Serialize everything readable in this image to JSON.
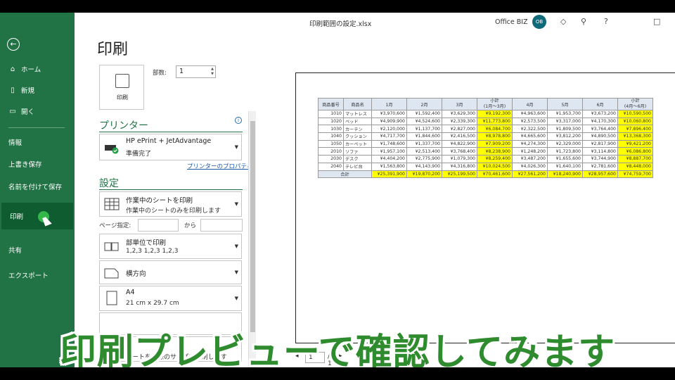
{
  "window": {
    "file_title": "印刷範囲の設定.xlsx",
    "account_name": "Office BIZ",
    "avatar_initials": "OB",
    "icons": [
      "diamond-icon",
      "share-icon",
      "help-icon",
      "maximize-icon"
    ],
    "help_label": "?"
  },
  "nav": {
    "back_label": "←",
    "items": [
      {
        "label": "ホーム",
        "icon": "home-icon"
      },
      {
        "label": "新規",
        "icon": "new-file-icon"
      },
      {
        "label": "開く",
        "icon": "folder-open-icon"
      },
      {
        "label": "情報"
      },
      {
        "label": "上書き保存"
      },
      {
        "label": "名前を付けて保存"
      },
      {
        "label": "印刷"
      },
      {
        "label": "共有"
      },
      {
        "label": "エクスポート"
      }
    ],
    "accent": "#217346"
  },
  "print": {
    "title": "印刷",
    "print_button_label": "印刷",
    "copies_label": "部数:",
    "copies_value": "1",
    "printer_section": "プリンター",
    "printer_name": "HP ePrint + JetAdvantage",
    "printer_status": "準備完了",
    "printer_properties": "プリンターのプロパティ",
    "settings_section": "設定",
    "settings": [
      {
        "line1": "作業中のシートを印刷",
        "line2": "作業中のシートのみを印刷します"
      },
      {
        "line1": "部単位で印刷",
        "line2": "1,2,3    1,2,3    1,2,3"
      },
      {
        "line1": "横方向",
        "line2": ""
      },
      {
        "line1": "A4",
        "line2": "21 cm x 29.7 cm"
      }
    ],
    "pages_label": "ページ指定:",
    "pages_to": "から",
    "scaling_partial": "シートを実際のサイズで印刷します"
  },
  "preview": {
    "page_current": "1",
    "page_total": "/ 1",
    "headers": [
      "商品番号",
      "商品名",
      "1月",
      "2月",
      "3月",
      "小計\n(1月～3月)",
      "4月",
      "5月",
      "6月",
      "小計\n(4月～6月)"
    ],
    "rows": [
      [
        "1010",
        "マットレス",
        "¥3,970,600",
        "¥1,592,400",
        "¥3,629,300",
        "¥9,192,300",
        "¥4,963,600",
        "¥1,953,700",
        "¥3,673,200",
        "¥10,590,500"
      ],
      [
        "1020",
        "ベッド",
        "¥4,909,900",
        "¥4,524,600",
        "¥2,339,300",
        "¥11,773,800",
        "¥2,573,500",
        "¥3,317,000",
        "¥4,170,300",
        "¥10,060,800"
      ],
      [
        "1030",
        "カーテン",
        "¥2,120,000",
        "¥1,137,700",
        "¥2,827,000",
        "¥6,084,700",
        "¥2,322,500",
        "¥1,809,500",
        "¥3,764,400",
        "¥7,896,400"
      ],
      [
        "1040",
        "クッション",
        "¥4,717,700",
        "¥1,844,600",
        "¥2,416,500",
        "¥8,978,800",
        "¥4,665,600",
        "¥3,812,200",
        "¥4,890,500",
        "¥13,368,300"
      ],
      [
        "1050",
        "カーペット",
        "¥1,748,600",
        "¥1,337,700",
        "¥4,822,900",
        "¥7,909,200",
        "¥4,274,300",
        "¥2,329,000",
        "¥2,817,900",
        "¥9,421,200"
      ],
      [
        "2010",
        "ソファ",
        "¥1,957,100",
        "¥2,513,400",
        "¥3,768,400",
        "¥8,238,900",
        "¥1,248,200",
        "¥1,723,800",
        "¥3,114,800",
        "¥6,086,800"
      ],
      [
        "2030",
        "デスク",
        "¥4,404,200",
        "¥2,775,900",
        "¥1,079,300",
        "¥8,259,400",
        "¥3,487,200",
        "¥1,655,600",
        "¥3,744,900",
        "¥8,887,700"
      ],
      [
        "2040",
        "テレビ台",
        "¥1,563,800",
        "¥4,143,900",
        "¥4,316,800",
        "¥10,024,500",
        "¥4,026,300",
        "¥1,640,100",
        "¥2,781,600",
        "¥8,448,000"
      ]
    ],
    "total_label": "合計",
    "totals": [
      "¥25,391,900",
      "¥19,870,200",
      "¥25,199,500",
      "¥70,461,600",
      "¥27,561,200",
      "¥18,240,900",
      "¥28,957,600",
      "¥74,759,700"
    ]
  },
  "caption": "印刷プレビューで確認してみます"
}
